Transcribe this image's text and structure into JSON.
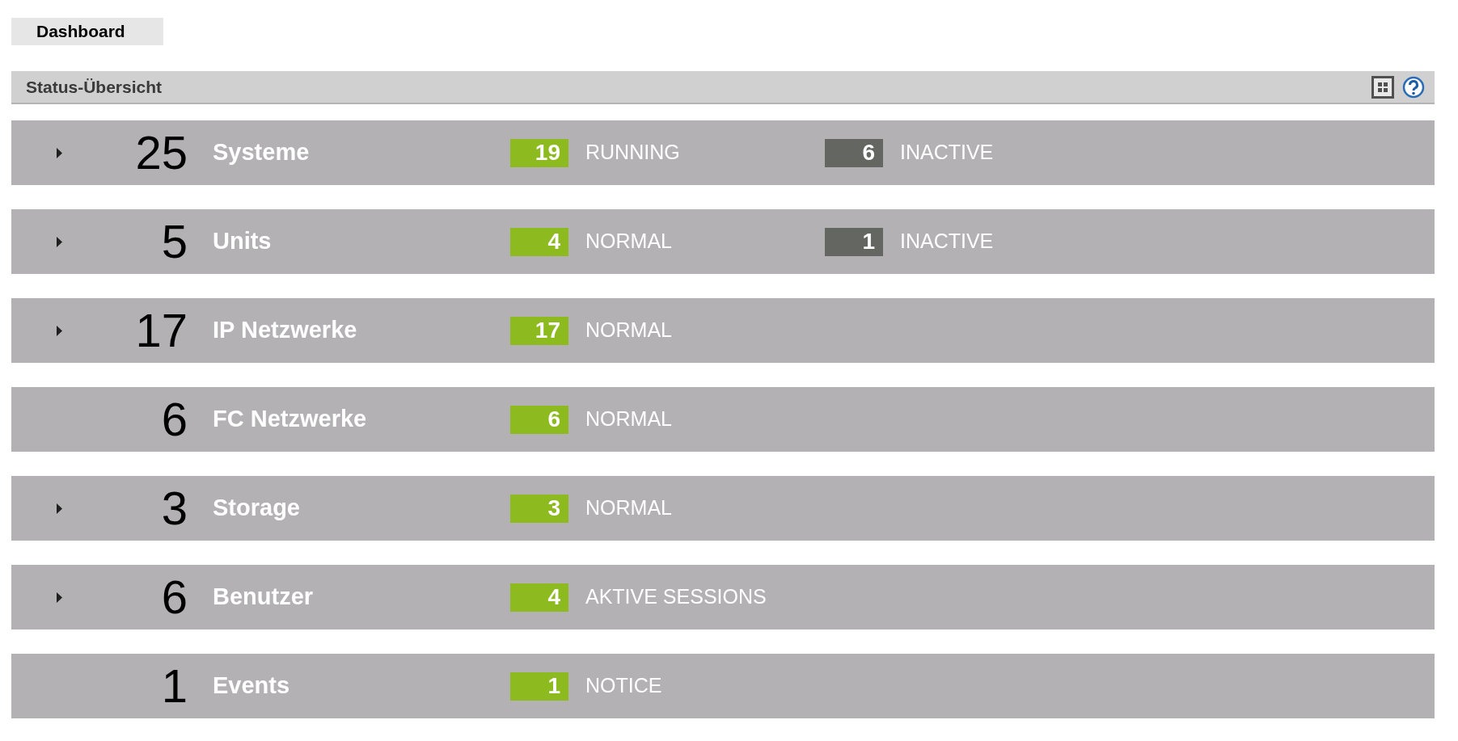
{
  "tab": {
    "label": "Dashboard",
    "selected": true
  },
  "panel": {
    "title": "Status-Übersicht"
  },
  "rows": [
    {
      "count": "25",
      "label": "Systeme",
      "expandable": true,
      "statuses": [
        {
          "count": "19",
          "label": "RUNNING",
          "color": "#8cba1f"
        },
        {
          "count": "6",
          "label": "INACTIVE",
          "color": "#646662"
        }
      ]
    },
    {
      "count": "5",
      "label": "Units",
      "expandable": true,
      "statuses": [
        {
          "count": "4",
          "label": "NORMAL",
          "color": "#8cba1f"
        },
        {
          "count": "1",
          "label": "INACTIVE",
          "color": "#646662"
        }
      ]
    },
    {
      "count": "17",
      "label": "IP Netzwerke",
      "expandable": true,
      "statuses": [
        {
          "count": "17",
          "label": "NORMAL",
          "color": "#8cba1f"
        }
      ]
    },
    {
      "count": "6",
      "label": "FC Netzwerke",
      "expandable": false,
      "statuses": [
        {
          "count": "6",
          "label": "NORMAL",
          "color": "#8cba1f"
        }
      ]
    },
    {
      "count": "3",
      "label": "Storage",
      "expandable": true,
      "statuses": [
        {
          "count": "3",
          "label": "NORMAL",
          "color": "#8cba1f"
        }
      ]
    },
    {
      "count": "6",
      "label": "Benutzer",
      "expandable": true,
      "statuses": [
        {
          "count": "4",
          "label": "AKTIVE SESSIONS",
          "color": "#8cba1f"
        }
      ]
    },
    {
      "count": "1",
      "label": "Events",
      "expandable": false,
      "statuses": [
        {
          "count": "1",
          "label": "NOTICE",
          "color": "#8cba1f"
        }
      ]
    }
  ]
}
